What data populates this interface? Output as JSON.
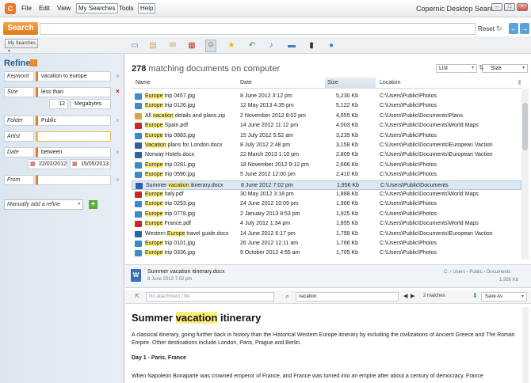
{
  "menu": {
    "file": "File",
    "edit": "Edit",
    "view": "View",
    "mysearches": "My Searches",
    "tools": "Tools",
    "help": "Help"
  },
  "app_title": "Copernic Desktop Search",
  "search": {
    "button": "Search",
    "reset": "Reset",
    "value": ""
  },
  "mysearches_dd": "My Searches",
  "filter_icons": [
    "image-icon",
    "document-icon",
    "email-icon",
    "calendar-icon",
    "contact-icon",
    "favorite-icon",
    "history-icon",
    "music-icon",
    "picture-icon",
    "video-icon",
    "web-icon"
  ],
  "refine": {
    "title": "Refine",
    "keyword": {
      "label": "Keyword",
      "value": "vacation to europe"
    },
    "size": {
      "label": "Size",
      "op": "less than",
      "value": "12",
      "unit": "Megabytes"
    },
    "folder": {
      "label": "Folder",
      "value": "Public"
    },
    "artist": {
      "label": "Artist",
      "value": ""
    },
    "date": {
      "label": "Date",
      "op": "between",
      "from": "22/02/2012",
      "to": "15/05/2013"
    },
    "from": {
      "label": "From",
      "value": ""
    },
    "manual_add": "Manually add a refine"
  },
  "results": {
    "count": "278",
    "count_text": "matching documents on computer",
    "view": "List",
    "sort": "Size",
    "columns": {
      "name": "Name",
      "date": "Date",
      "size": "Size",
      "location": "Location"
    },
    "rows": [
      {
        "icon": "jpg",
        "pre": "",
        "hl": "Europe",
        "post": " trip 0457.jpg",
        "date": "8 June 2012  3:12 pm",
        "size": "5,230 Kb",
        "loc": "C:\\Users\\Public\\Photos"
      },
      {
        "icon": "jpg",
        "pre": "",
        "hl": "Europe",
        "post": " trip 0126.jpg",
        "date": "12 May 2013  4:35 pm",
        "size": "5,122 Kb",
        "loc": "C:\\Users\\Public\\Photos"
      },
      {
        "icon": "zip",
        "pre": "All ",
        "hl": "vacation",
        "post": " details and plans.zip",
        "date": "2 November 2012  8:02 pm",
        "size": "4,655 Kb",
        "loc": "C:\\Users\\Public\\Documents\\Plans"
      },
      {
        "icon": "pdf",
        "pre": "",
        "hl": "Europe",
        "post": " Spain.pdf",
        "date": "14 June 2012  11:12 pm",
        "size": "4,003 Kb",
        "loc": "C:\\Users\\Public\\Documents\\World Maps"
      },
      {
        "icon": "jpg",
        "pre": "",
        "hl": "Europe",
        "post": " trip 0883.jpg",
        "date": "15 July 2012  5:52 am",
        "size": "3,235 Kb",
        "loc": "C:\\Users\\Public\\Photos"
      },
      {
        "icon": "doc",
        "pre": "",
        "hl": "Vacation",
        "post": " plans for London.docx",
        "date": "8 July 2012  2:48 pm",
        "size": "3,158 Kb",
        "loc": "C:\\Users\\Public\\Documents\\European Vaction"
      },
      {
        "icon": "doc",
        "pre": "Norway Hotels.docx",
        "hl": "",
        "post": "",
        "date": "22 March 2013  1:10 pm",
        "size": "2,809 Kb",
        "loc": "C:\\Users\\Public\\Documents\\European Vaction"
      },
      {
        "icon": "jpg",
        "pre": "",
        "hl": "Europe",
        "post": " trip 0281.jpg",
        "date": "18 November 2012  9:12 pm",
        "size": "2,666 Kb",
        "loc": "C:\\Users\\Public\\Photos"
      },
      {
        "icon": "jpg",
        "pre": "",
        "hl": "Europe",
        "post": " trip 0590.jpg",
        "date": "5 June 2012  12:00 pm",
        "size": "2,410 Kb",
        "loc": "C:\\Users\\Public\\Photos"
      },
      {
        "icon": "doc",
        "pre": "Summer ",
        "hl": "vacation",
        "post": " itinerary.docx",
        "date": "8 June 2012  7:02 pm",
        "size": "1,956 Kb",
        "loc": "C:\\Users\\Public\\Documents",
        "selected": true
      },
      {
        "icon": "pdf",
        "pre": "",
        "hl": "Europe",
        "post": " Italy.pdf",
        "date": "30 May 2012  3:18 pm",
        "size": "1,888 Kb",
        "loc": "C:\\Users\\Public\\Documents\\World Maps"
      },
      {
        "icon": "jpg",
        "pre": "",
        "hl": "Europe",
        "post": " trip 0253.jpg",
        "date": "24 June 2012  10:09 pm",
        "size": "1,966 Kb",
        "loc": "C:\\Users\\Public\\Photos"
      },
      {
        "icon": "jpg",
        "pre": "",
        "hl": "Europe",
        "post": " trip 0778.jpg",
        "date": "2 January 2013  8:53 pm",
        "size": "1,925 Kb",
        "loc": "C:\\Users\\Public\\Photos"
      },
      {
        "icon": "pdf",
        "pre": "",
        "hl": "Europe",
        "post": " France.pdf",
        "date": "4 July 2012  1:34 pm",
        "size": "1,855 Kb",
        "loc": "C:\\Users\\Public\\Documents\\World Maps"
      },
      {
        "icon": "doc",
        "pre": "Western ",
        "hl": "Europe",
        "post": " travel guide.docx",
        "date": "14 June 2012  6:17 pm",
        "size": "1,799 Kb",
        "loc": "C:\\Users\\Public\\Documents\\European Vaction"
      },
      {
        "icon": "jpg",
        "pre": "",
        "hl": "Europe",
        "post": " trip 0101.jpg",
        "date": "26 June 2012  12:11 am",
        "size": "1,766 Kb",
        "loc": "C:\\Users\\Public\\Photos"
      },
      {
        "icon": "jpg",
        "pre": "",
        "hl": "Europe",
        "post": " trip 0336.jpg",
        "date": "9 October 2012  4:55 am",
        "size": "1,705 Kb",
        "loc": "C:\\Users\\Public\\Photos"
      }
    ]
  },
  "preview": {
    "title": "Summer vacation itinerary.docx",
    "date": "8 June 2012  7:02 pm",
    "breadcrumb": [
      "C:",
      "Users",
      "Public",
      "Documents"
    ],
    "size": "1,956 Kb",
    "attach_placeholder": "No attachment / file",
    "find": "vacation",
    "matches": "2 matches",
    "save_as": "Save As",
    "doc": {
      "title_pre": "Summer ",
      "title_hl": "vacation",
      "title_post": " itinerary",
      "p1": "A classical itinerary, going further back in history than the Historical Western Europe itinerary by including the civilizations of Ancient Greece and The Roman Empire. Other destinations include London, Paris, Prague and Berlin.",
      "day1": "Day 1 - Paris, France",
      "p2": "When Napoleon Bonaparte was crowned emperor of France, and France was turned into an empire after about a century of democracy, France"
    }
  },
  "colors": {
    "accent": "#e8792a",
    "highlight": "#fdf07a",
    "link": "#4a7fb5"
  }
}
